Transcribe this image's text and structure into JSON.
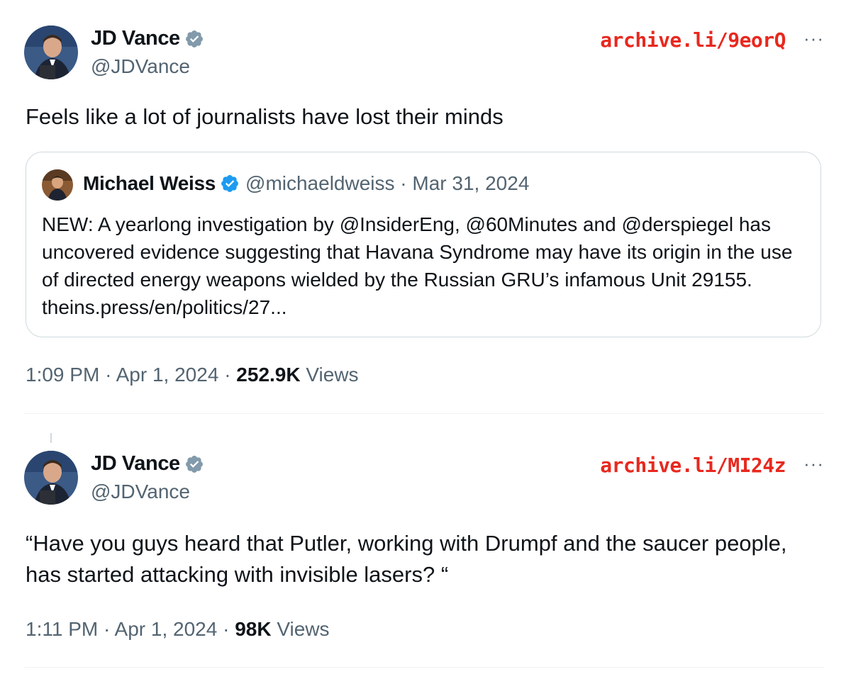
{
  "tweets": [
    {
      "author": {
        "name": "JD Vance",
        "handle": "@JDVance"
      },
      "archive_link": "archive.li/9eorQ",
      "more_label": "···",
      "text": "Feels like a lot of journalists have lost their minds",
      "quote": {
        "author": {
          "name": "Michael Weiss",
          "handle": "@michaeldweiss",
          "date": "Mar 31, 2024"
        },
        "separator": "·",
        "text": "NEW: A yearlong investigation by @InsiderEng, @60Minutes and @derspiegel has uncovered evidence suggesting that Havana Syndrome may have its origin in the use of directed energy weapons wielded by the Russian GRU’s infamous Unit 29155.  theins.press/en/politics/27..."
      },
      "time": "1:09 PM",
      "date": "Apr 1, 2024",
      "views_count": "252.9K",
      "views_label": "Views"
    },
    {
      "author": {
        "name": "JD Vance",
        "handle": "@JDVance"
      },
      "archive_link": "archive.li/MI24z",
      "more_label": "···",
      "text": "“Have you guys heard that Putler, working with Drumpf and the saucer people, has started attacking with invisible lasers? “",
      "time": "1:11 PM",
      "date": "Apr 1, 2024",
      "views_count": "98K",
      "views_label": "Views"
    }
  ],
  "colors": {
    "verified_blue": "#1d9bf0",
    "archive_red": "#e8281e",
    "secondary_text": "#536471",
    "primary_text": "#0f1419",
    "border": "#cfd9de"
  },
  "icons": {
    "verified": "verified-badge-icon",
    "more": "more-options-icon"
  }
}
